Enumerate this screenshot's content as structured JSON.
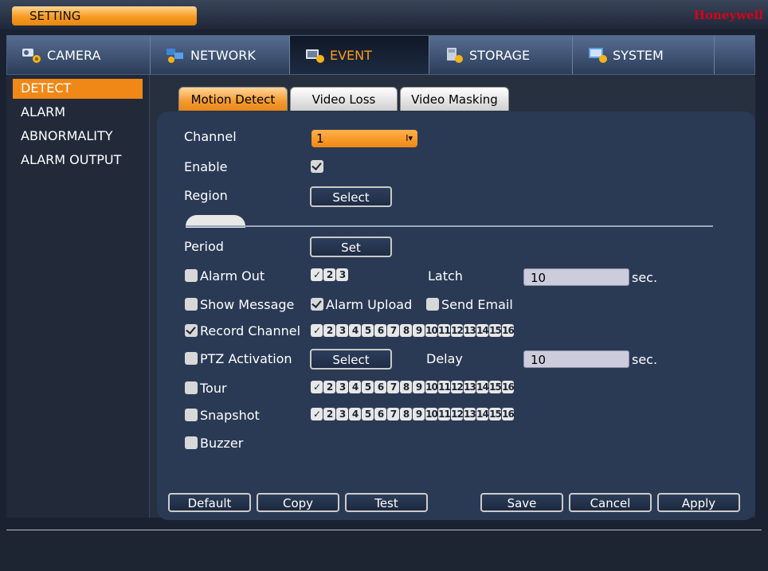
{
  "window": {
    "title": "SETTING",
    "brand": "Honeywell"
  },
  "nav": {
    "tabs": [
      {
        "label": "CAMERA",
        "icon": "camera-icon"
      },
      {
        "label": "NETWORK",
        "icon": "network-icon"
      },
      {
        "label": "EVENT",
        "icon": "event-icon",
        "active": true
      },
      {
        "label": "STORAGE",
        "icon": "storage-icon"
      },
      {
        "label": "SYSTEM",
        "icon": "system-icon"
      }
    ]
  },
  "sidebar": {
    "items": [
      {
        "label": "DETECT",
        "active": true
      },
      {
        "label": "ALARM"
      },
      {
        "label": "ABNORMALITY"
      },
      {
        "label": "ALARM OUTPUT"
      }
    ]
  },
  "subtabs": [
    "Motion Detect",
    "Video Loss",
    "Video Masking"
  ],
  "form": {
    "channel_label": "Channel",
    "channel_value": "1",
    "enable_label": "Enable",
    "enable_checked": true,
    "region_label": "Region",
    "region_button": "Select",
    "period_label": "Period",
    "period_button": "Set",
    "alarm_out_label": "Alarm Out",
    "alarm_out_channels": [
      "✓",
      "2",
      "3"
    ],
    "latch_label": "Latch",
    "latch_value": "10",
    "latch_unit": "sec.",
    "show_message_label": "Show Message",
    "alarm_upload_label": "Alarm Upload",
    "send_email_label": "Send Email",
    "record_channel_label": "Record Channel",
    "ptz_label": "PTZ Activation",
    "ptz_button": "Select",
    "delay_label": "Delay",
    "delay_value": "10",
    "delay_unit": "sec.",
    "tour_label": "Tour",
    "snapshot_label": "Snapshot",
    "buzzer_label": "Buzzer",
    "channels16": [
      "✓",
      "2",
      "3",
      "4",
      "5",
      "6",
      "7",
      "8",
      "9",
      "10",
      "11",
      "12",
      "13",
      "14",
      "15",
      "16"
    ]
  },
  "buttons": {
    "default": "Default",
    "copy": "Copy",
    "test": "Test",
    "save": "Save",
    "cancel": "Cancel",
    "apply": "Apply"
  },
  "colors": {
    "accent": "#f08817",
    "brand": "#d7001b",
    "panel": "#2a3a55"
  }
}
